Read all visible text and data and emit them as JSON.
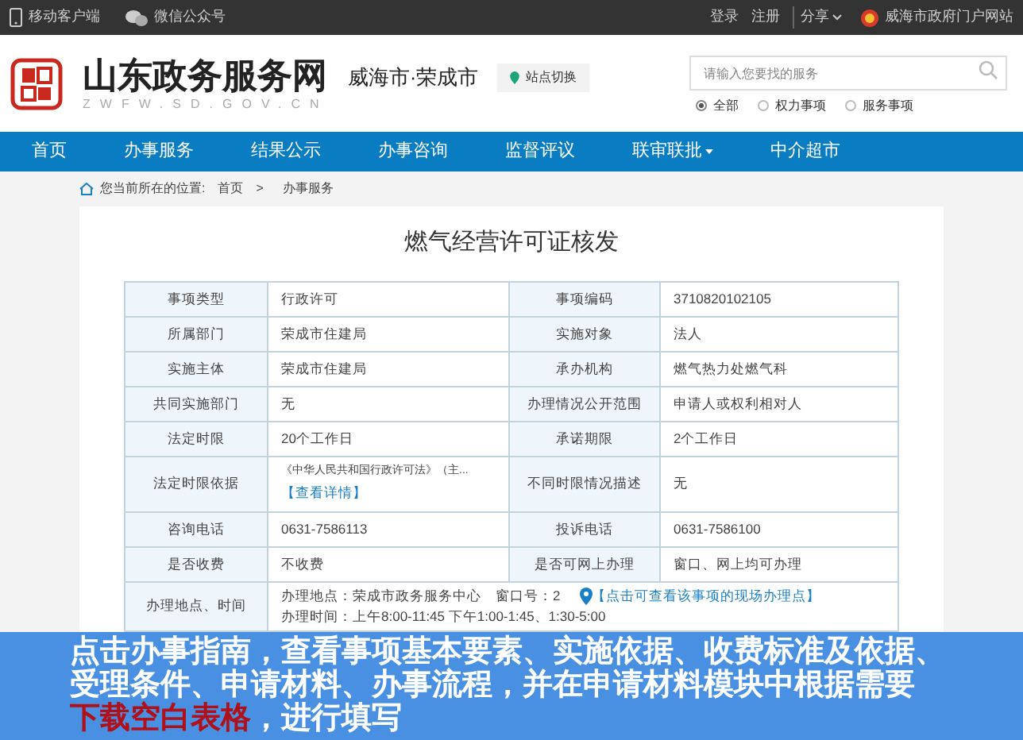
{
  "top_bar": {
    "left": [
      {
        "kind": "phone",
        "label": "移动客户端"
      },
      {
        "kind": "wechat",
        "label": "微信公众号"
      }
    ],
    "login": "登录",
    "register": "注册",
    "share": "分享",
    "portal": "威海市政府门户网站"
  },
  "header": {
    "site_name": "山东政务服务网",
    "domain": "ZWFW.SD.GOV.CN",
    "region": "威海市·荣成市",
    "switch_button": "站点切换",
    "search": {
      "placeholder": "请输入您要找的服务"
    },
    "scopes": [
      {
        "label": "全部",
        "selected": true
      },
      {
        "label": "权力事项",
        "selected": false
      },
      {
        "label": "服务事项",
        "selected": false
      }
    ]
  },
  "nav": [
    {
      "label": "首页",
      "dropdown": false
    },
    {
      "label": "办事服务",
      "dropdown": false
    },
    {
      "label": "结果公示",
      "dropdown": false
    },
    {
      "label": "办事咨询",
      "dropdown": false
    },
    {
      "label": "监督评议",
      "dropdown": false
    },
    {
      "label": "联审联批",
      "dropdown": true
    },
    {
      "label": "中介超市",
      "dropdown": false
    }
  ],
  "breadcrumb": {
    "prefix": "您当前所在的位置:",
    "items": [
      "首页",
      "办事服务"
    ],
    "separator": ">"
  },
  "title": "燃气经营许可证核发",
  "table": [
    {
      "kind": "pair",
      "cells": [
        {
          "label": "事项类型",
          "value": "行政许可"
        },
        {
          "label": "事项编码",
          "value": "3710820102105"
        }
      ]
    },
    {
      "kind": "pair",
      "cells": [
        {
          "label": "所属部门",
          "value": "荣成市住建局"
        },
        {
          "label": "实施对象",
          "value": "法人"
        }
      ]
    },
    {
      "kind": "pair",
      "cells": [
        {
          "label": "实施主体",
          "value": "荣成市住建局"
        },
        {
          "label": "承办机构",
          "value": "燃气热力处燃气科"
        }
      ]
    },
    {
      "kind": "pair",
      "cells": [
        {
          "label": "共同实施部门",
          "value": "无"
        },
        {
          "label": "办理情况公开范围",
          "value": "申请人或权利相对人"
        }
      ]
    },
    {
      "kind": "pair",
      "cells": [
        {
          "label": "法定时限",
          "value": "20个工作日"
        },
        {
          "label": "承诺期限",
          "value": "2个工作日"
        }
      ]
    },
    {
      "kind": "pair",
      "cells": [
        {
          "label": "法定时限依据",
          "value": "《中华人民共和国行政许可法》（主...",
          "link": "【查看详情】"
        },
        {
          "label": "不同时限情况描述",
          "value": "无"
        }
      ]
    },
    {
      "kind": "pair",
      "cells": [
        {
          "label": "咨询电话",
          "value": "0631-7586113"
        },
        {
          "label": "投诉电话",
          "value": "0631-7586100"
        }
      ]
    },
    {
      "kind": "pair",
      "cells": [
        {
          "label": "是否收费",
          "value": "不收费"
        },
        {
          "label": "是否可网上办理",
          "value": "窗口、网上均可办理"
        }
      ]
    },
    {
      "kind": "location",
      "label": "办理地点、时间",
      "place": "办理地点：荣成市政务服务中心　窗口号：2",
      "map_link": "【点击可查看该事项的现场办理点】",
      "hours": "办理时间：上午8:00-11:45 下午1:00-1:45、1:30-5:00"
    }
  ],
  "caption": {
    "lines": [
      [
        {
          "text": "点击办事指南，查看事项基本要素、实施依据、收费标准及依据、",
          "highlight": false
        }
      ],
      [
        {
          "text": "受理条件、申请材料、办事流程，并在申请材料模块中根据需要",
          "highlight": false
        }
      ],
      [
        {
          "text": "下载空白表格",
          "highlight": true
        },
        {
          "text": "，进行填写",
          "highlight": false
        }
      ]
    ]
  }
}
